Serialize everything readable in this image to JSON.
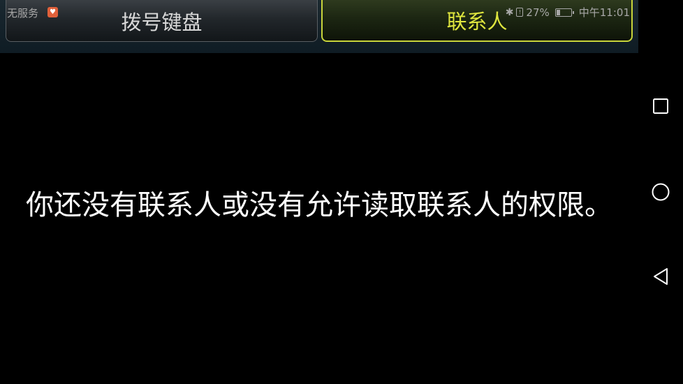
{
  "status_bar": {
    "carrier": "无服务",
    "battery_percent": "27%",
    "battery_level": 0.27,
    "time": "中午11:01"
  },
  "tabs": [
    {
      "label": "拨号键盘",
      "selected": false
    },
    {
      "label": "联系人",
      "selected": true
    }
  ],
  "empty_message": "你还没有联系人或没有允许读取联系人的权限。",
  "colors": {
    "selected_tab_text": "#dfe63e",
    "selected_tab_border": "#c8d43a",
    "unselected_tab_text": "#d8d8d8",
    "background": "#000000"
  },
  "nav_bar": {
    "icons": [
      "recents-icon",
      "home-icon",
      "back-icon"
    ]
  }
}
